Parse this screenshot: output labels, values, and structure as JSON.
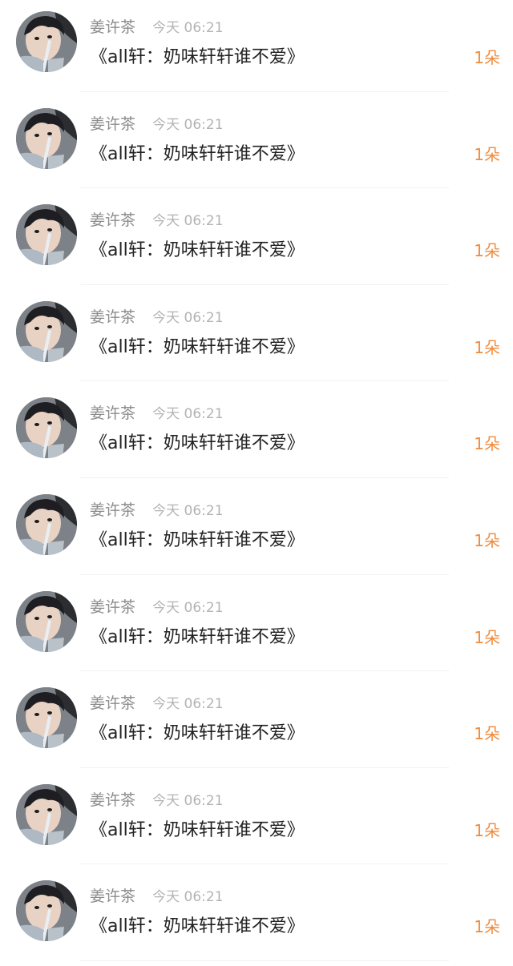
{
  "entries": [
    {
      "name": "姜许茶",
      "time": "今天 06:21",
      "title": "《all轩：奶味轩轩谁不爱》",
      "count": "1朵",
      "avatar_icon": "user-avatar"
    },
    {
      "name": "姜许茶",
      "time": "今天 06:21",
      "title": "《all轩：奶味轩轩谁不爱》",
      "count": "1朵",
      "avatar_icon": "user-avatar"
    },
    {
      "name": "姜许茶",
      "time": "今天 06:21",
      "title": "《all轩：奶味轩轩谁不爱》",
      "count": "1朵",
      "avatar_icon": "user-avatar"
    },
    {
      "name": "姜许茶",
      "time": "今天 06:21",
      "title": "《all轩：奶味轩轩谁不爱》",
      "count": "1朵",
      "avatar_icon": "user-avatar"
    },
    {
      "name": "姜许茶",
      "time": "今天 06:21",
      "title": "《all轩：奶味轩轩谁不爱》",
      "count": "1朵",
      "avatar_icon": "user-avatar"
    },
    {
      "name": "姜许茶",
      "time": "今天 06:21",
      "title": "《all轩：奶味轩轩谁不爱》",
      "count": "1朵",
      "avatar_icon": "user-avatar"
    },
    {
      "name": "姜许茶",
      "time": "今天 06:21",
      "title": "《all轩：奶味轩轩谁不爱》",
      "count": "1朵",
      "avatar_icon": "user-avatar"
    },
    {
      "name": "姜许茶",
      "time": "今天 06:21",
      "title": "《all轩：奶味轩轩谁不爱》",
      "count": "1朵",
      "avatar_icon": "user-avatar"
    },
    {
      "name": "姜许茶",
      "time": "今天 06:21",
      "title": "《all轩：奶味轩轩谁不爱》",
      "count": "1朵",
      "avatar_icon": "user-avatar"
    },
    {
      "name": "姜许茶",
      "time": "今天 06:21",
      "title": "《all轩：奶味轩轩谁不爱》",
      "count": "1朵",
      "avatar_icon": "user-avatar"
    }
  ],
  "colors": {
    "name": "#8c8c8c",
    "time": "#b3b3b3",
    "title": "#222222",
    "count": "#f08a3c",
    "divider": "#f1f1f1"
  }
}
